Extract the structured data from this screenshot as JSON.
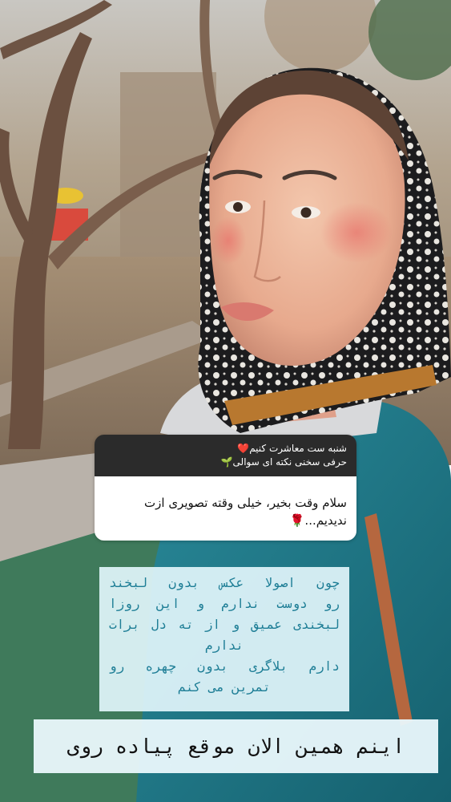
{
  "story": {
    "question_box": {
      "prompt_line1": "شنبه ست معاشرت کنیم❤️",
      "prompt_line2": "حرفی سخنی نکته ای سوالی🌱",
      "answer": "سلام وقت بخیر، خیلی وقته تصویری ازت ندیدیم...🌹"
    },
    "caption_lines": [
      "چون اصولا عکس بدون لبخند",
      "رو دوست ندارم و این روزا",
      "لبخندی عمیق و از ته دل برات",
      "ندارم",
      "دارم بلاگری بدون چهره رو",
      "تمرین می کنم"
    ],
    "bottom_caption": "اینم همین الان موقع پیاده روی"
  },
  "colors": {
    "caption_text": "#1e7e96",
    "caption_bg": "#e0f4fa",
    "question_header_bg": "#2b2b2b",
    "jacket": "#1f7f8f",
    "scarf": "#1a1a1a"
  }
}
